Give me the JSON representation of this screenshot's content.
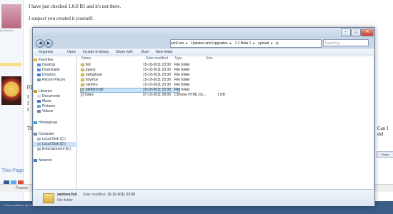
{
  "forum": {
    "post_line1": "I have just checked 1.0.0 B1 and it's not there.",
    "post_line2": "I suspect you created it yourself.",
    "role": "Moderator",
    "quote_char": "[Q",
    "i_1": "I",
    "i_2": "I",
    "i_3": "I",
    "th": "Th",
    "cut_right": "Can I del",
    "reply_button": "Reply",
    "this_page": "This Page",
    "nav_forums": "Forums",
    "footer_text": "Forum software by XenForo™ ©2010"
  },
  "window": {
    "address_crumbs": [
      "xenForo",
      "Updates and Upgrades",
      "1.1 Beta 1",
      "upload",
      "js"
    ],
    "search_placeholder": "Search js",
    "toolbar": {
      "organize": "Organize",
      "open": "Open",
      "include_library": "Include in library",
      "share": "Share with",
      "burn": "Burn",
      "new_folder": "New folder"
    },
    "nav": {
      "favorites": "Favorites",
      "desktop": "Desktop",
      "downloads": "Downloads",
      "dropbox": "Dropbox",
      "recent": "Recent Places",
      "libraries": "Libraries",
      "documents": "Documents",
      "music": "Music",
      "pictures": "Pictures",
      "videos": "Videos",
      "homegroup": "Homegroup",
      "computer": "Computer",
      "local_c": "Local Disk (C:)",
      "local_d": "Local Disk (D:)",
      "entertainment": "Entertainment (E:)",
      "network": "Network"
    },
    "columns": {
      "name": "Name",
      "date": "Date modified",
      "type": "Type",
      "size": "Size"
    },
    "files": [
      {
        "name": "flot",
        "date": "15-10-2011 23:30",
        "type": "File folder",
        "size": ""
      },
      {
        "name": "jquery",
        "date": "15-10-2011 23:30",
        "type": "File folder",
        "size": ""
      },
      {
        "name": "swfupload",
        "date": "15-10-2011 23:30",
        "type": "File folder",
        "size": ""
      },
      {
        "name": "tinymce",
        "date": "15-10-2011 23:30",
        "type": "File folder",
        "size": ""
      },
      {
        "name": "xenforo",
        "date": "15-10-2011 23:30",
        "type": "File folder",
        "size": ""
      },
      {
        "name": "xenforo.full",
        "date": "15-10-2011 23:30",
        "type": "File folder",
        "size": ""
      },
      {
        "name": "index",
        "date": "07-10-2011 09:06",
        "type": "Chrome HTML Do...",
        "size": "1 KB"
      }
    ],
    "details": {
      "name": "xenforo.full",
      "date_label": "Date modified:",
      "date_value": "15-10-2011 23:30",
      "type": "File folder"
    }
  },
  "colors": {
    "titlebar": "#c3d3e7",
    "selection": "#cce4f7",
    "folder": "#e7c45a"
  }
}
